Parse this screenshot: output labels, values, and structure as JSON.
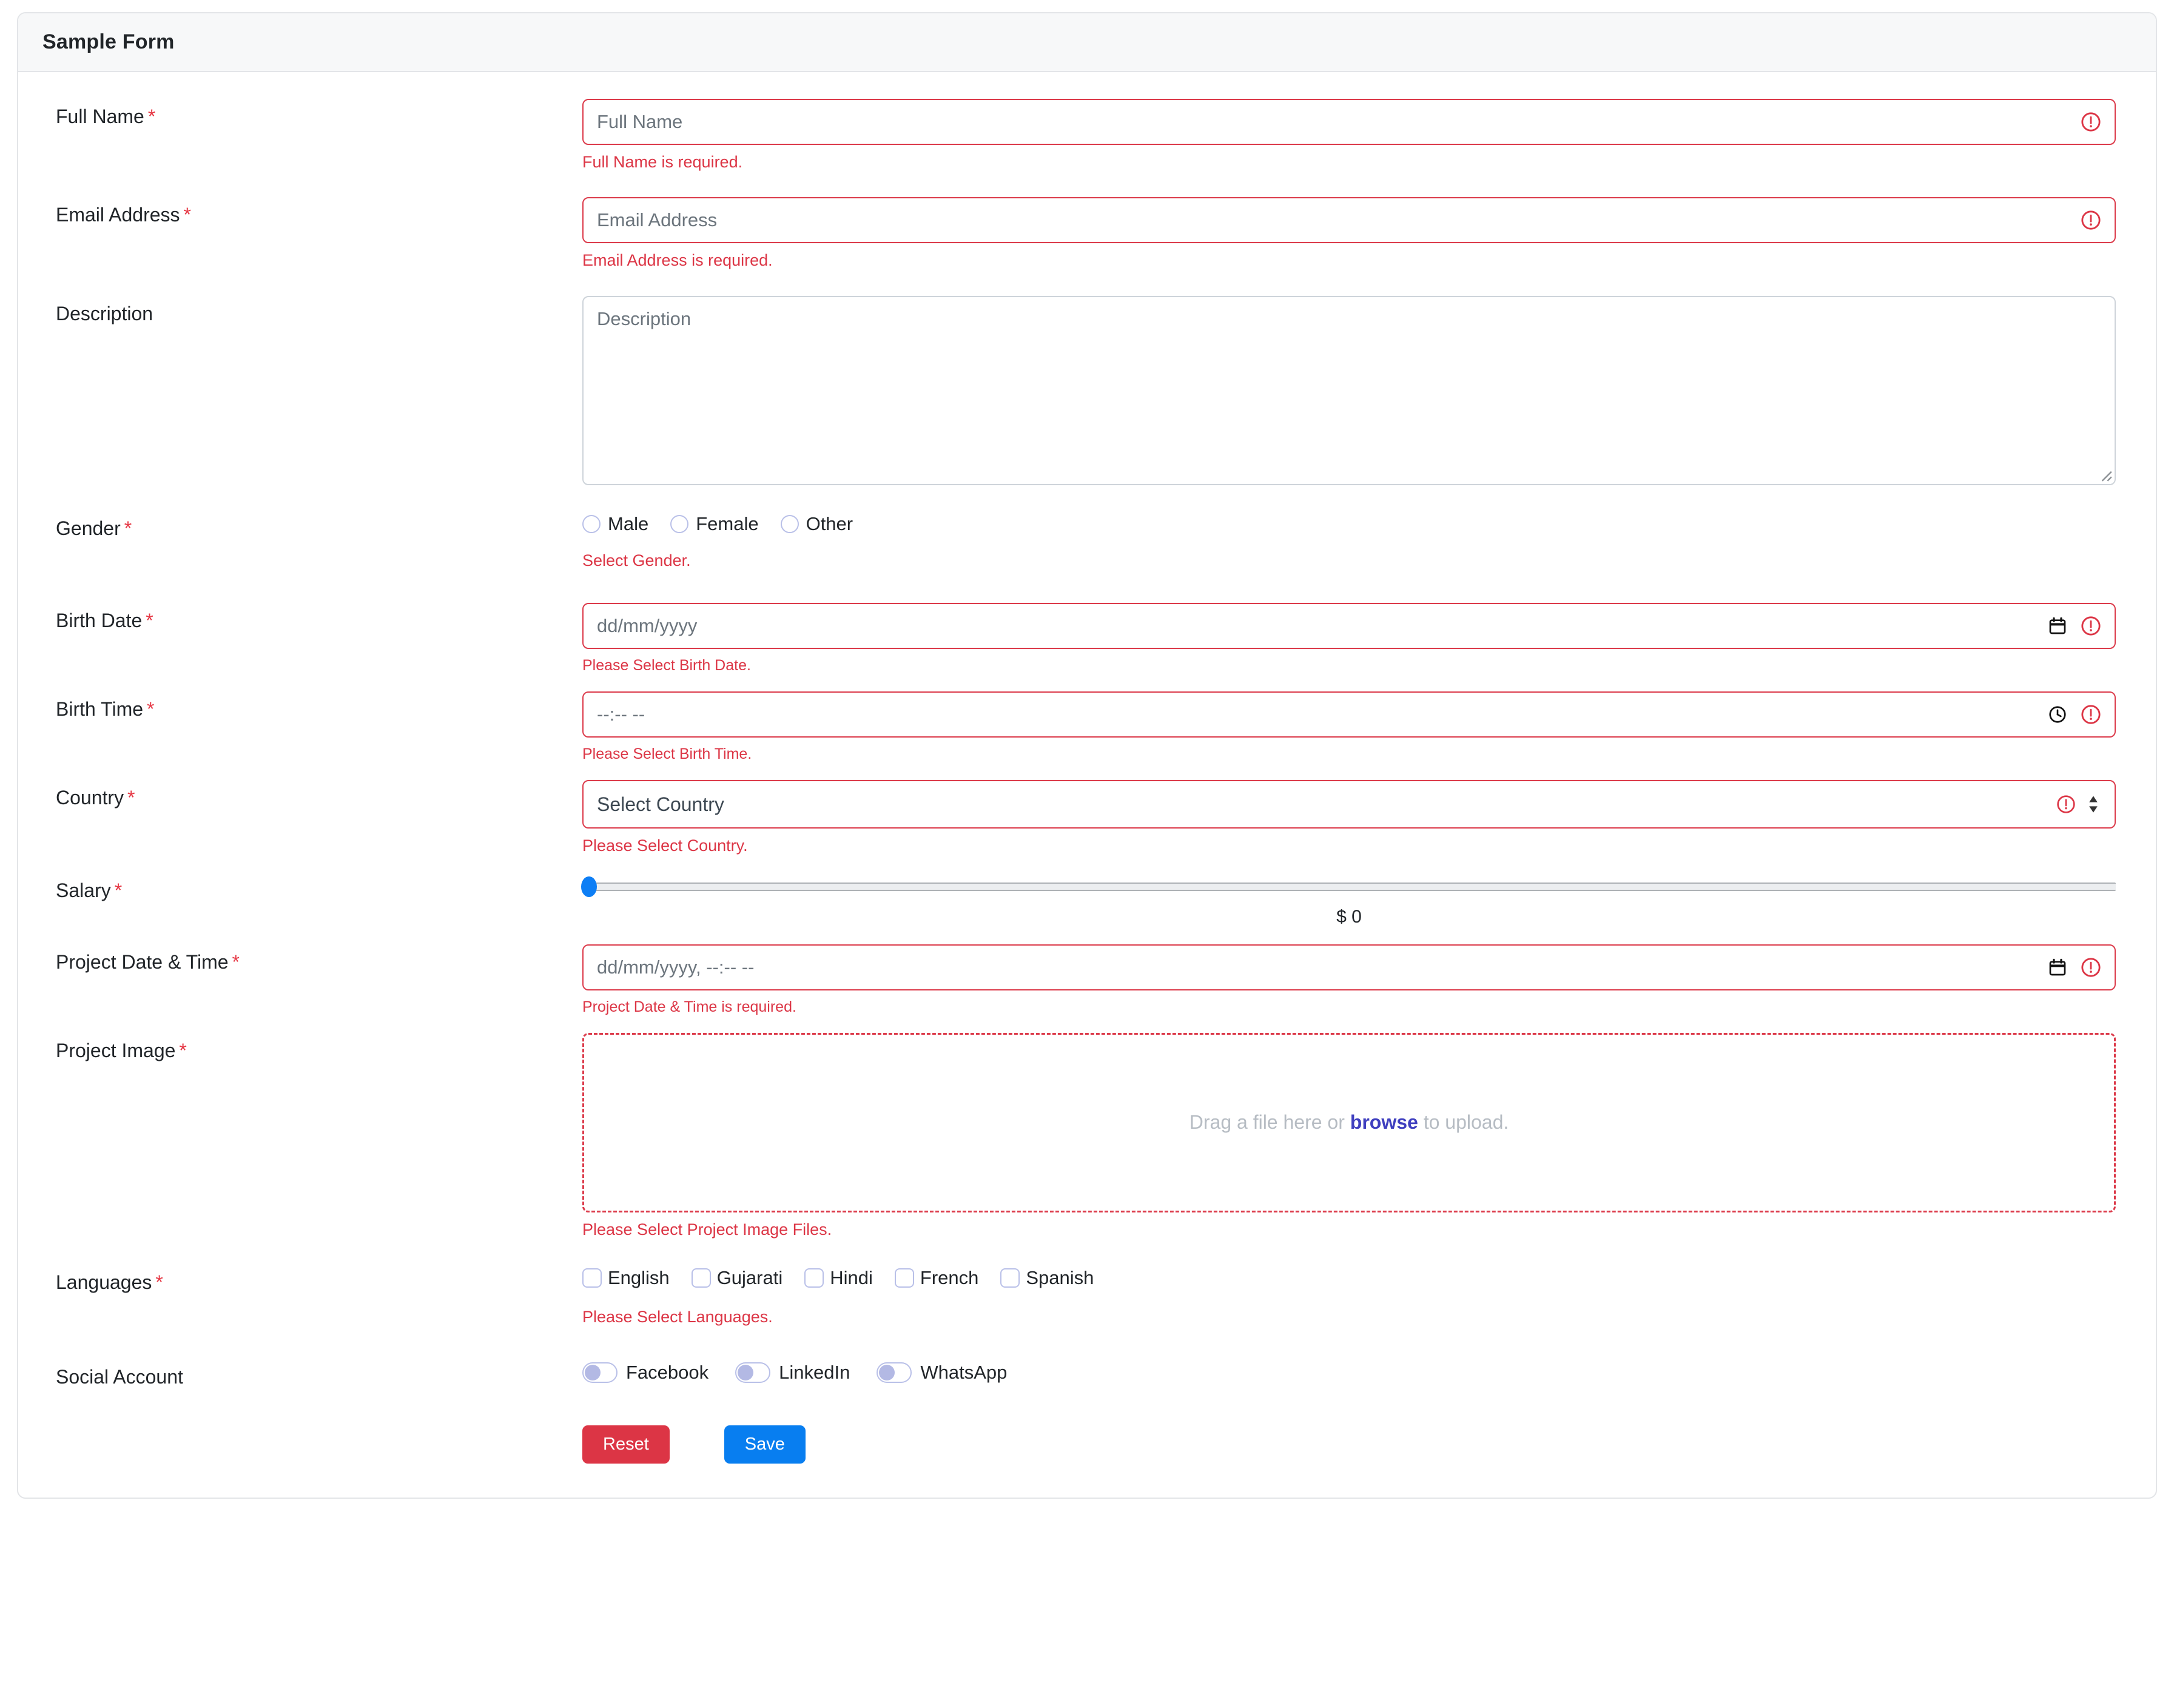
{
  "form": {
    "title": "Sample Form",
    "fields": {
      "full_name": {
        "label": "Full Name",
        "required": "*",
        "placeholder": "Full Name",
        "value": "",
        "error": "Full Name is required."
      },
      "email": {
        "label": "Email Address",
        "required": "*",
        "placeholder": "Email Address",
        "value": "",
        "error": "Email Address is required."
      },
      "description": {
        "label": "Description",
        "placeholder": "Description",
        "value": ""
      },
      "gender": {
        "label": "Gender",
        "required": "*",
        "options": [
          "Male",
          "Female",
          "Other"
        ],
        "selected": "",
        "error": "Select Gender."
      },
      "birth_date": {
        "label": "Birth Date",
        "required": "*",
        "placeholder": "dd/mm/yyyy",
        "value": "",
        "error": "Please Select Birth Date."
      },
      "birth_time": {
        "label": "Birth Time",
        "required": "*",
        "placeholder": "--:-- --",
        "value": "",
        "error": "Please Select Birth Time."
      },
      "country": {
        "label": "Country",
        "required": "*",
        "selected_option": "Select Country",
        "error": "Please Select Country."
      },
      "salary": {
        "label": "Salary",
        "required": "*",
        "value": 0,
        "min": 0,
        "max": 100,
        "display_value": "$ 0"
      },
      "project_datetime": {
        "label": "Project Date & Time",
        "required": "*",
        "placeholder": "dd/mm/yyyy, --:-- --",
        "value": "",
        "error": "Project Date & Time is required."
      },
      "project_image": {
        "label": "Project Image",
        "required": "*",
        "drop_prefix": "Drag a file here or ",
        "drop_link": "browse",
        "drop_suffix": " to upload.",
        "error": "Please Select Project Image Files."
      },
      "languages": {
        "label": "Languages",
        "required": "*",
        "options": [
          "English",
          "Gujarati",
          "Hindi",
          "French",
          "Spanish"
        ],
        "selected": [],
        "error": "Please Select Languages."
      },
      "social_account": {
        "label": "Social Account",
        "options": [
          "Facebook",
          "LinkedIn",
          "WhatsApp"
        ],
        "states": [
          false,
          false,
          false
        ]
      }
    },
    "actions": {
      "reset_label": "Reset",
      "save_label": "Save"
    },
    "colors": {
      "error": "#dc3545",
      "error_border": "#dc3b4b",
      "accent_blue": "#087ef0",
      "browse_link": "#3f3fbf",
      "control_border": "#b9c0e8"
    }
  }
}
